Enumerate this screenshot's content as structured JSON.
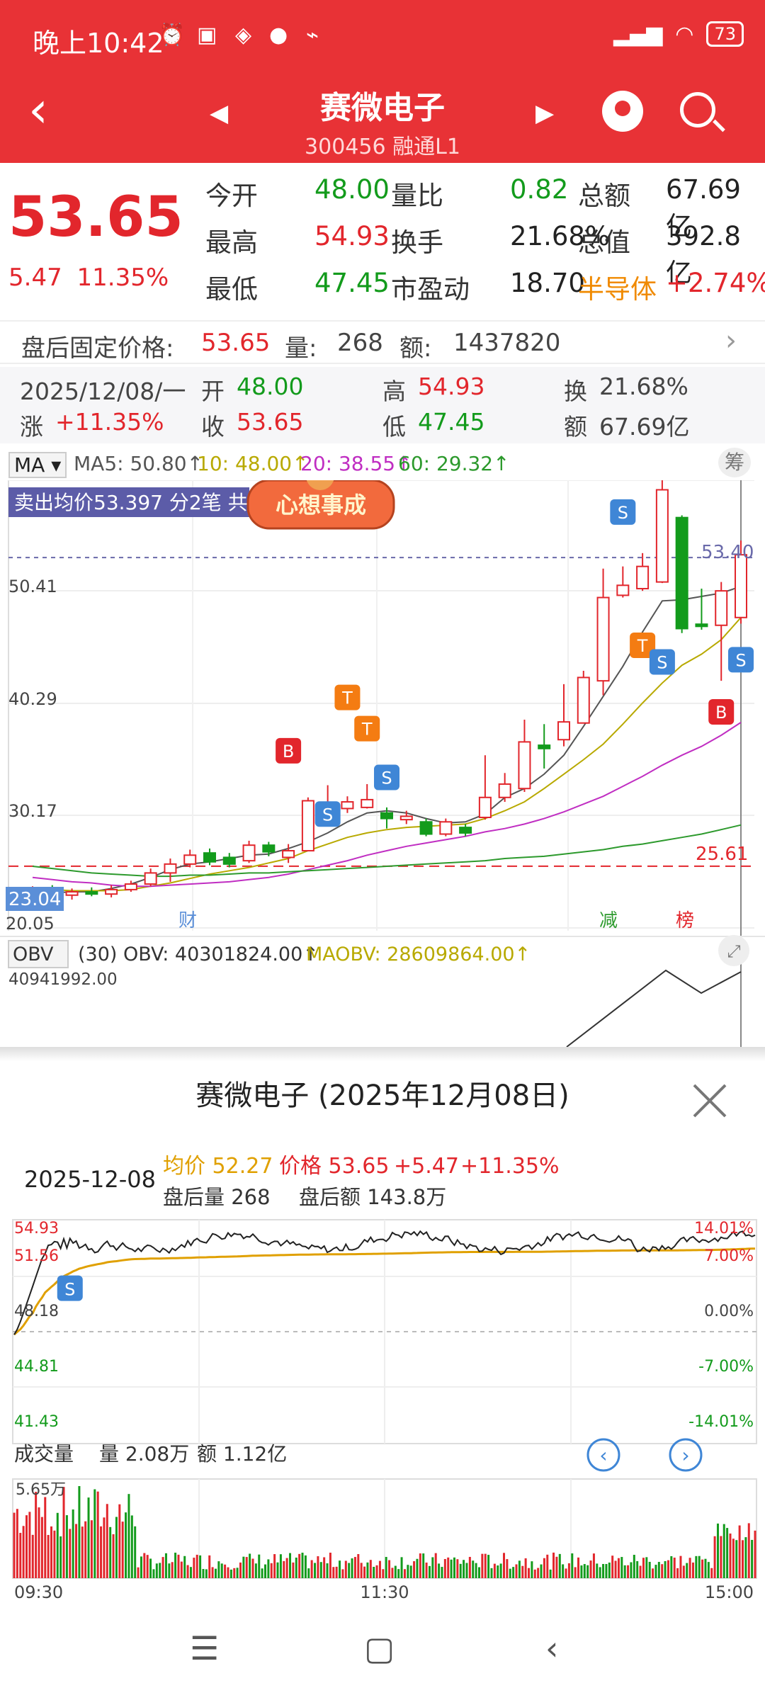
{
  "status_bar": {
    "time": "晚上10:42",
    "battery": "73"
  },
  "header": {
    "stock_name": "赛微电子",
    "stock_code": "300456",
    "tags": "融通L1"
  },
  "quote": {
    "price": "53.65",
    "change": "5.47",
    "change_pct": "11.35%",
    "cells": [
      {
        "label": "今开",
        "value": "48.00",
        "color": "green"
      },
      {
        "label": "量比",
        "value": "0.82",
        "color": "green"
      },
      {
        "label": "总额",
        "value": "67.69亿",
        "color": "dark"
      },
      {
        "label": "最高",
        "value": "54.93",
        "color": "red"
      },
      {
        "label": "换手",
        "value": "21.68%",
        "color": "dark"
      },
      {
        "label": "总值",
        "value": "392.8亿",
        "color": "dark"
      },
      {
        "label": "最低",
        "value": "47.45",
        "color": "green"
      },
      {
        "label": "市盈动",
        "value": "18.70",
        "color": "dark"
      },
      {
        "label": "半导体",
        "value": "+2.74%",
        "color": "red"
      }
    ]
  },
  "after_hours": {
    "label": "盘后固定价格:",
    "price": "53.65",
    "vol_label": "量:",
    "vol": "268",
    "amt_label": "额:",
    "amt": "1437820"
  },
  "kline_info": {
    "date": "2025/12/08/一",
    "open_label": "开",
    "open": "48.00",
    "high_label": "高",
    "high": "54.93",
    "turn_label": "换",
    "turn": "21.68%",
    "chg_label": "涨",
    "chg": "+11.35%",
    "close_label": "收",
    "close": "53.65",
    "low_label": "低",
    "low": "47.45",
    "amt_label": "额",
    "amt": "67.69亿"
  },
  "ma_line": {
    "selector": "MA",
    "ma5": "MA5: 50.80↑",
    "ma10": "10: 48.00↑",
    "ma20": "20: 38.55↑",
    "ma60": "60: 29.32↑",
    "chip_button": "筹"
  },
  "kline_chart": {
    "banner": "卖出均价53.397 分2笔 共",
    "sticker": "心想事成",
    "y_labels": [
      "50.41",
      "40.29",
      "30.17",
      "20.05"
    ],
    "dashed_level": "53.40",
    "low_tag": "23.04",
    "red_level": "25.61",
    "markers": [
      "财",
      "减",
      "榜"
    ],
    "signal_labels": {
      "buy": "B",
      "sell": "S",
      "t": "T"
    },
    "candles": [
      {
        "o": 23.1,
        "c": 23.4,
        "h": 23.8,
        "l": 22.8
      },
      {
        "o": 23.4,
        "c": 23.0,
        "h": 23.9,
        "l": 22.7
      },
      {
        "o": 23.0,
        "c": 23.3,
        "h": 23.6,
        "l": 22.6
      },
      {
        "o": 23.3,
        "c": 23.1,
        "h": 23.7,
        "l": 22.9
      },
      {
        "o": 23.1,
        "c": 23.5,
        "h": 23.9,
        "l": 22.8
      },
      {
        "o": 23.5,
        "c": 24.0,
        "h": 24.3,
        "l": 23.3
      },
      {
        "o": 24.0,
        "c": 25.0,
        "h": 25.4,
        "l": 23.8
      },
      {
        "o": 25.0,
        "c": 25.8,
        "h": 26.3,
        "l": 24.2
      },
      {
        "o": 25.8,
        "c": 26.6,
        "h": 27.1,
        "l": 25.5
      },
      {
        "o": 26.8,
        "c": 26.0,
        "h": 27.2,
        "l": 25.7
      },
      {
        "o": 26.4,
        "c": 25.8,
        "h": 26.8,
        "l": 25.5
      },
      {
        "o": 26.1,
        "c": 27.5,
        "h": 27.9,
        "l": 25.9
      },
      {
        "o": 27.5,
        "c": 26.9,
        "h": 27.8,
        "l": 26.5
      },
      {
        "o": 26.4,
        "c": 27.0,
        "h": 27.6,
        "l": 25.9
      },
      {
        "o": 27.0,
        "c": 31.5,
        "h": 31.8,
        "l": 27.0
      },
      {
        "o": 30.8,
        "c": 31.3,
        "h": 32.9,
        "l": 30.6
      },
      {
        "o": 30.8,
        "c": 31.4,
        "h": 31.9,
        "l": 30.4
      },
      {
        "o": 30.9,
        "c": 31.6,
        "h": 33.0,
        "l": 30.8
      },
      {
        "o": 30.4,
        "c": 29.9,
        "h": 30.9,
        "l": 29.0
      },
      {
        "o": 29.8,
        "c": 30.1,
        "h": 30.6,
        "l": 29.4
      },
      {
        "o": 29.6,
        "c": 28.5,
        "h": 29.9,
        "l": 28.3
      },
      {
        "o": 28.5,
        "c": 29.6,
        "h": 29.9,
        "l": 28.3
      },
      {
        "o": 29.1,
        "c": 28.6,
        "h": 29.4,
        "l": 28.3
      },
      {
        "o": 30.0,
        "c": 31.8,
        "h": 35.6,
        "l": 29.8
      },
      {
        "o": 31.8,
        "c": 33.0,
        "h": 34.0,
        "l": 31.4
      },
      {
        "o": 32.6,
        "c": 36.8,
        "h": 38.8,
        "l": 32.3
      },
      {
        "o": 36.5,
        "c": 36.2,
        "h": 38.4,
        "l": 34.4
      },
      {
        "o": 37.0,
        "c": 38.6,
        "h": 42.0,
        "l": 36.4
      },
      {
        "o": 38.5,
        "c": 42.6,
        "h": 43.2,
        "l": 38.5
      },
      {
        "o": 42.3,
        "c": 49.8,
        "h": 52.4,
        "l": 41.0
      },
      {
        "o": 50.0,
        "c": 50.9,
        "h": 52.6,
        "l": 49.8
      },
      {
        "o": 50.6,
        "c": 52.6,
        "h": 53.8,
        "l": 50.4
      },
      {
        "o": 51.2,
        "c": 59.5,
        "h": 60.8,
        "l": 51.1
      },
      {
        "o": 57.0,
        "c": 47.0,
        "h": 57.2,
        "l": 46.6
      },
      {
        "o": 47.4,
        "c": 47.2,
        "h": 50.6,
        "l": 46.9
      },
      {
        "o": 47.3,
        "c": 50.4,
        "h": 51.2,
        "l": 42.3
      },
      {
        "o": 48.0,
        "c": 53.65,
        "h": 54.93,
        "l": 47.45
      }
    ],
    "ma5": [
      23.2,
      23.2,
      23.3,
      23.3,
      23.6,
      24.0,
      24.6,
      25.3,
      25.8,
      26.0,
      26.3,
      26.6,
      26.7,
      27.2,
      27.8,
      28.6,
      29.6,
      30.4,
      30.6,
      30.4,
      29.9,
      29.5,
      29.6,
      30.3,
      31.8,
      32.6,
      33.9,
      35.6,
      38.2,
      40.9,
      43.6,
      46.7,
      49.5,
      49.6,
      49.9,
      50.2,
      50.8
    ],
    "ma10": [
      23.6,
      23.5,
      23.4,
      23.4,
      23.4,
      23.5,
      23.8,
      24.1,
      24.5,
      24.9,
      25.2,
      25.5,
      25.9,
      26.3,
      27.0,
      27.6,
      28.2,
      28.6,
      28.9,
      29.1,
      29.2,
      29.3,
      29.4,
      29.9,
      30.6,
      31.4,
      32.6,
      33.9,
      35.2,
      36.6,
      38.4,
      40.3,
      42.1,
      43.7,
      44.7,
      46.0,
      48.0
    ],
    "ma20": [
      24.6,
      24.4,
      24.2,
      24.1,
      23.9,
      23.8,
      23.8,
      23.9,
      24.0,
      24.1,
      24.2,
      24.4,
      24.6,
      24.9,
      25.3,
      25.7,
      26.1,
      26.6,
      27.0,
      27.4,
      27.7,
      28.0,
      28.3,
      28.7,
      29.0,
      29.4,
      29.9,
      30.5,
      31.2,
      31.9,
      32.8,
      33.7,
      34.7,
      35.6,
      36.4,
      37.4,
      38.55
    ],
    "ma60": [
      25.6,
      25.4,
      25.2,
      25.0,
      24.9,
      24.8,
      24.7,
      24.7,
      24.8,
      24.8,
      24.9,
      25.0,
      25.0,
      25.1,
      25.2,
      25.3,
      25.4,
      25.5,
      25.6,
      25.7,
      25.8,
      25.9,
      26.0,
      26.1,
      26.3,
      26.4,
      26.5,
      26.7,
      26.9,
      27.1,
      27.4,
      27.6,
      27.9,
      28.2,
      28.5,
      28.9,
      29.32
    ]
  },
  "obv_line": {
    "selector": "OBV",
    "params": "(30) OBV: 40301824.00↑",
    "maobv": "MAOBV: 28609864.00↑",
    "axis_value": "40941992.00"
  },
  "intraday": {
    "title": "赛微电子 (2025年12月08日)",
    "date": "2025-12-08",
    "avg": "均价 52.27",
    "price": "价格 53.65",
    "chg": "+5.47",
    "chg_pct": "+11.35%",
    "ah_vol": "盘后量 268",
    "ah_amt": "盘后额 143.8万",
    "y_left": [
      "54.93",
      "51.56",
      "48.18",
      "44.81",
      "41.43"
    ],
    "y_right": [
      "14.01%",
      "7.00%",
      "0.00%",
      "-7.00%",
      "-14.01%"
    ],
    "volume_title": "成交量",
    "volume": "量 2.08万",
    "amount": "额 1.12亿",
    "vol_max": "5.65万",
    "x_labels": [
      "09:30",
      "11:30",
      "15:00"
    ]
  }
}
